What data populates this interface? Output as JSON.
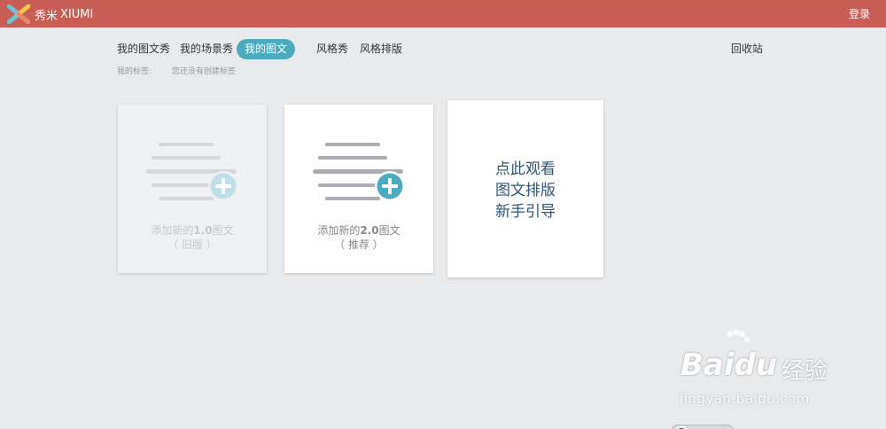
{
  "header": {
    "brand_cn": "秀米",
    "brand_en": "XIUMI",
    "login_label": "登录",
    "accent_color": "#c85d55"
  },
  "nav": {
    "items": [
      {
        "label": "我的图文秀"
      },
      {
        "label": "我的场景秀"
      },
      {
        "label": "我的图文",
        "active": true
      },
      {
        "label": "风格秀"
      },
      {
        "label": "风格排版"
      }
    ],
    "recycle_label": "回收站",
    "active_color": "#4aabbf"
  },
  "tags": {
    "label": "我的标签:",
    "empty_text": "您还没有创建标签"
  },
  "cards": {
    "old": {
      "line1_prefix": "添加新的",
      "line1_version": "1.0",
      "line1_suffix": "图文",
      "line2": "（ 旧版 ）",
      "icon": "add-document-icon"
    },
    "new": {
      "line1_prefix": "添加新的",
      "line1_version": "2.0",
      "line1_suffix": "图文",
      "line2": "（ 推荐 ）",
      "icon": "add-document-icon"
    },
    "guide": {
      "line1": "点此观看",
      "line2": "图文排版",
      "line3": "新手引导"
    }
  },
  "watermark": {
    "brand": "Bai",
    "brand_suffix": "du",
    "cn": "经验",
    "url": "jingyan.baidu.com"
  }
}
